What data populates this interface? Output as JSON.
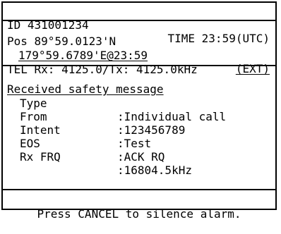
{
  "header": {
    "id_text": "ID 431001234",
    "time_text": "TIME 23:59(UTC)"
  },
  "position": {
    "lat_text": "Pos 89°59.0123'N",
    "lon_text": "179°59.6789'E@23:59",
    "source_text": "(EXT)"
  },
  "tel": {
    "text": "TEL Rx: 4125.0/Tx: 4125.0kHz"
  },
  "message": {
    "title": "Received safety message",
    "fields": [
      {
        "label": "Type",
        "value": ":Individual call"
      },
      {
        "label": "From",
        "value": ":123456789"
      },
      {
        "label": "Intent",
        "value": ":Test"
      },
      {
        "label": "EOS",
        "value": ":ACK RQ"
      },
      {
        "label": "Rx FRQ",
        "value": ":16804.5kHz"
      }
    ]
  },
  "footer": {
    "text": "Press CANCEL to silence alarm."
  }
}
